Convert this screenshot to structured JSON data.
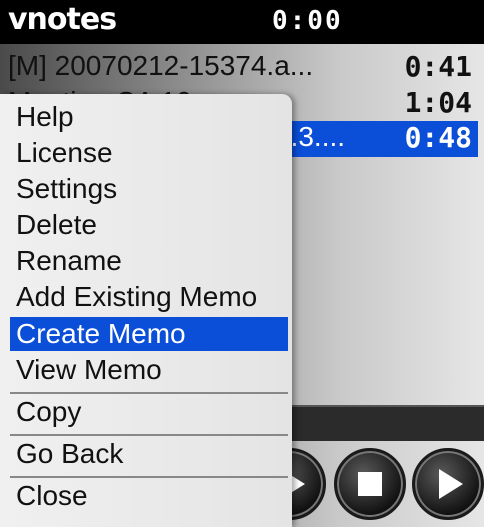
{
  "app": {
    "title": "vnotes",
    "timer": "0:00"
  },
  "memos": [
    {
      "name": "[M] 20070212-15374.a...",
      "duration": "0:41"
    },
    {
      "name": "Meeting CA 10",
      "duration": "1:04"
    },
    {
      "name": "...3....",
      "duration": "0:48"
    }
  ],
  "menu": {
    "items": [
      "Help",
      "License",
      "Settings",
      "Delete",
      "Rename",
      "Add Existing Memo",
      "Create Memo",
      "View Memo"
    ],
    "copy": "Copy",
    "go_back": "Go Back",
    "close": "Close"
  },
  "colors": {
    "selection": "#0b4fd8",
    "title_bar": "#000000"
  },
  "controls": [
    "play-icon",
    "stop-icon",
    "play-icon"
  ]
}
